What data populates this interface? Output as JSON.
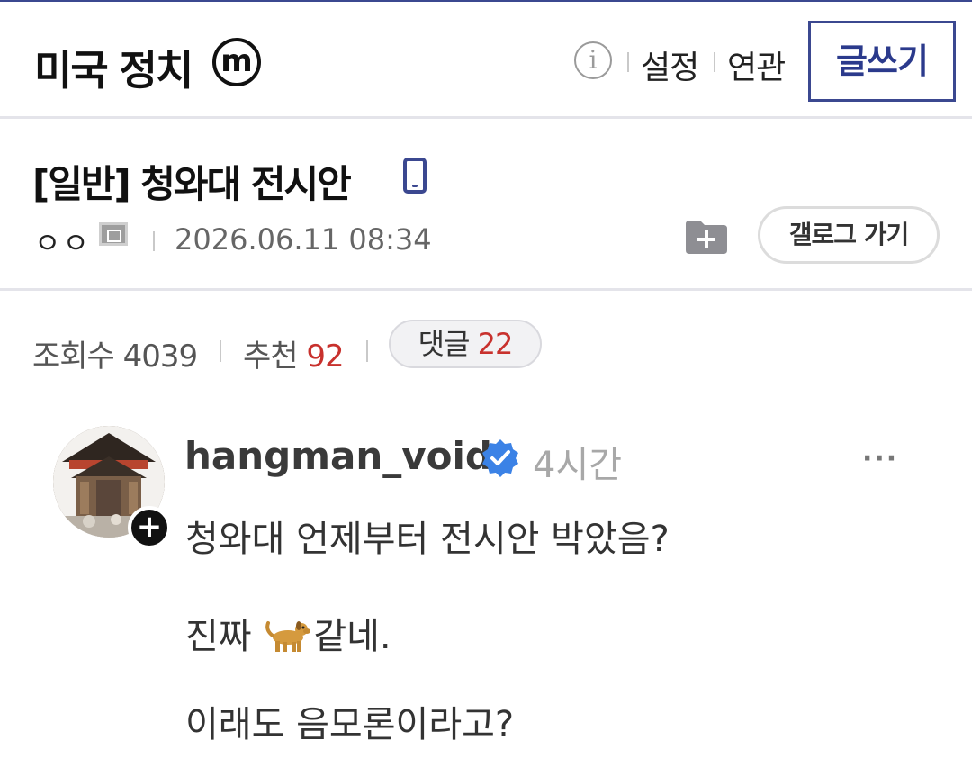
{
  "header": {
    "gallery_title": "미국 정치",
    "badge": "m",
    "info_label": "i",
    "settings": "설정",
    "related": "연관",
    "write_button": "글쓰기"
  },
  "post": {
    "title": "[일반] 청와대 전시안",
    "author": "ㅇㅇ",
    "date": "2026.06.11 08:34",
    "gallog_button": "갤로그 가기"
  },
  "stats": {
    "views_label": "조회수",
    "views": "4039",
    "recommend_label": "추천",
    "recommend": "92",
    "comments_label": "댓글",
    "comments": "22"
  },
  "embed": {
    "username": "hangman_void",
    "time": "4시간",
    "more": "···",
    "plus": "+",
    "line1": "청와대 언제부터 전시안 박았음?",
    "line2_a": "진짜 ",
    "line2_b": "같네.",
    "line3": "이래도 음모론이라고?"
  },
  "colors": {
    "accent": "#3b4890",
    "red": "#c8312d",
    "verified": "#3b82e6"
  }
}
